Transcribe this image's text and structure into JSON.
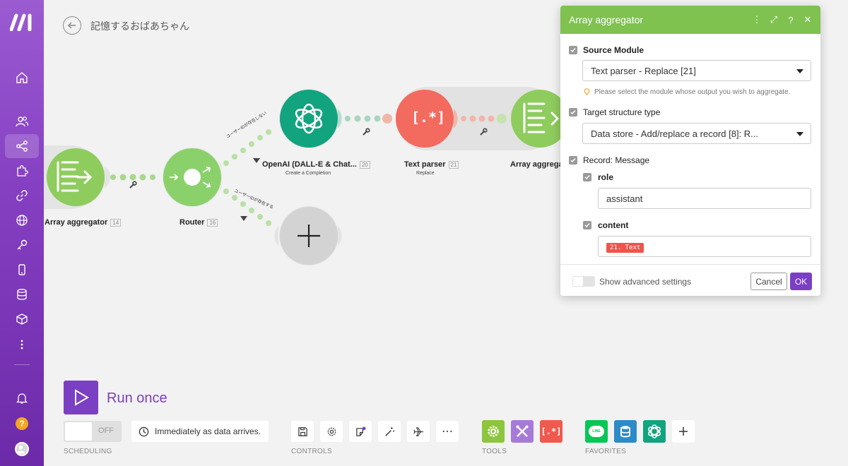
{
  "scenario": {
    "title": "記憶するおばあちゃん"
  },
  "nodes": {
    "aggregator_left": {
      "label": "Array aggregator",
      "badge": "14"
    },
    "router": {
      "label": "Router",
      "badge": "16"
    },
    "openai": {
      "label": "OpenAI (DALL-E & Chat...",
      "badge": "20",
      "sub": "Create a Completion"
    },
    "text_parser": {
      "label": "Text parser",
      "badge": "21",
      "sub": "Replace",
      "icon_text": "[.*]"
    },
    "aggregator_right": {
      "label": "Array aggrega"
    }
  },
  "routes": {
    "top": "ユーザーIDが存在しない",
    "bottom": "ユーザーIDが存在する"
  },
  "bottom": {
    "run_label": "Run once",
    "toggle_label": "OFF",
    "schedule_text": "Immediately as data arrives.",
    "sections": {
      "scheduling": "SCHEDULING",
      "controls": "CONTROLS",
      "tools": "TOOLS",
      "favorites": "FAVORITES"
    },
    "controls_more": "⋯",
    "tool_parser_text": "[.*]",
    "fav_line_text": "LINE"
  },
  "panel": {
    "title": "Array aggregator",
    "header_icons": [
      "more-icon",
      "expand-icon",
      "help-icon",
      "close-icon"
    ],
    "source_module": {
      "label": "Source Module",
      "value": "Text parser - Replace [21]",
      "hint": "Please select the module whose output you wish to aggregate."
    },
    "target_structure": {
      "label": "Target structure type",
      "value": "Data store - Add/replace a record [8]: R..."
    },
    "record": {
      "label": "Record: Message"
    },
    "role": {
      "label": "role",
      "value": "assistant"
    },
    "content": {
      "label": "content",
      "pill": "21. Text"
    },
    "advanced_label": "Show advanced settings",
    "cancel_label": "Cancel",
    "ok_label": "OK"
  },
  "colors": {
    "brand": "#7b3fc4",
    "module_green": "#7fc24f",
    "openai": "#10a37f",
    "parser": "#f0594e",
    "router": "#8bd16b"
  }
}
